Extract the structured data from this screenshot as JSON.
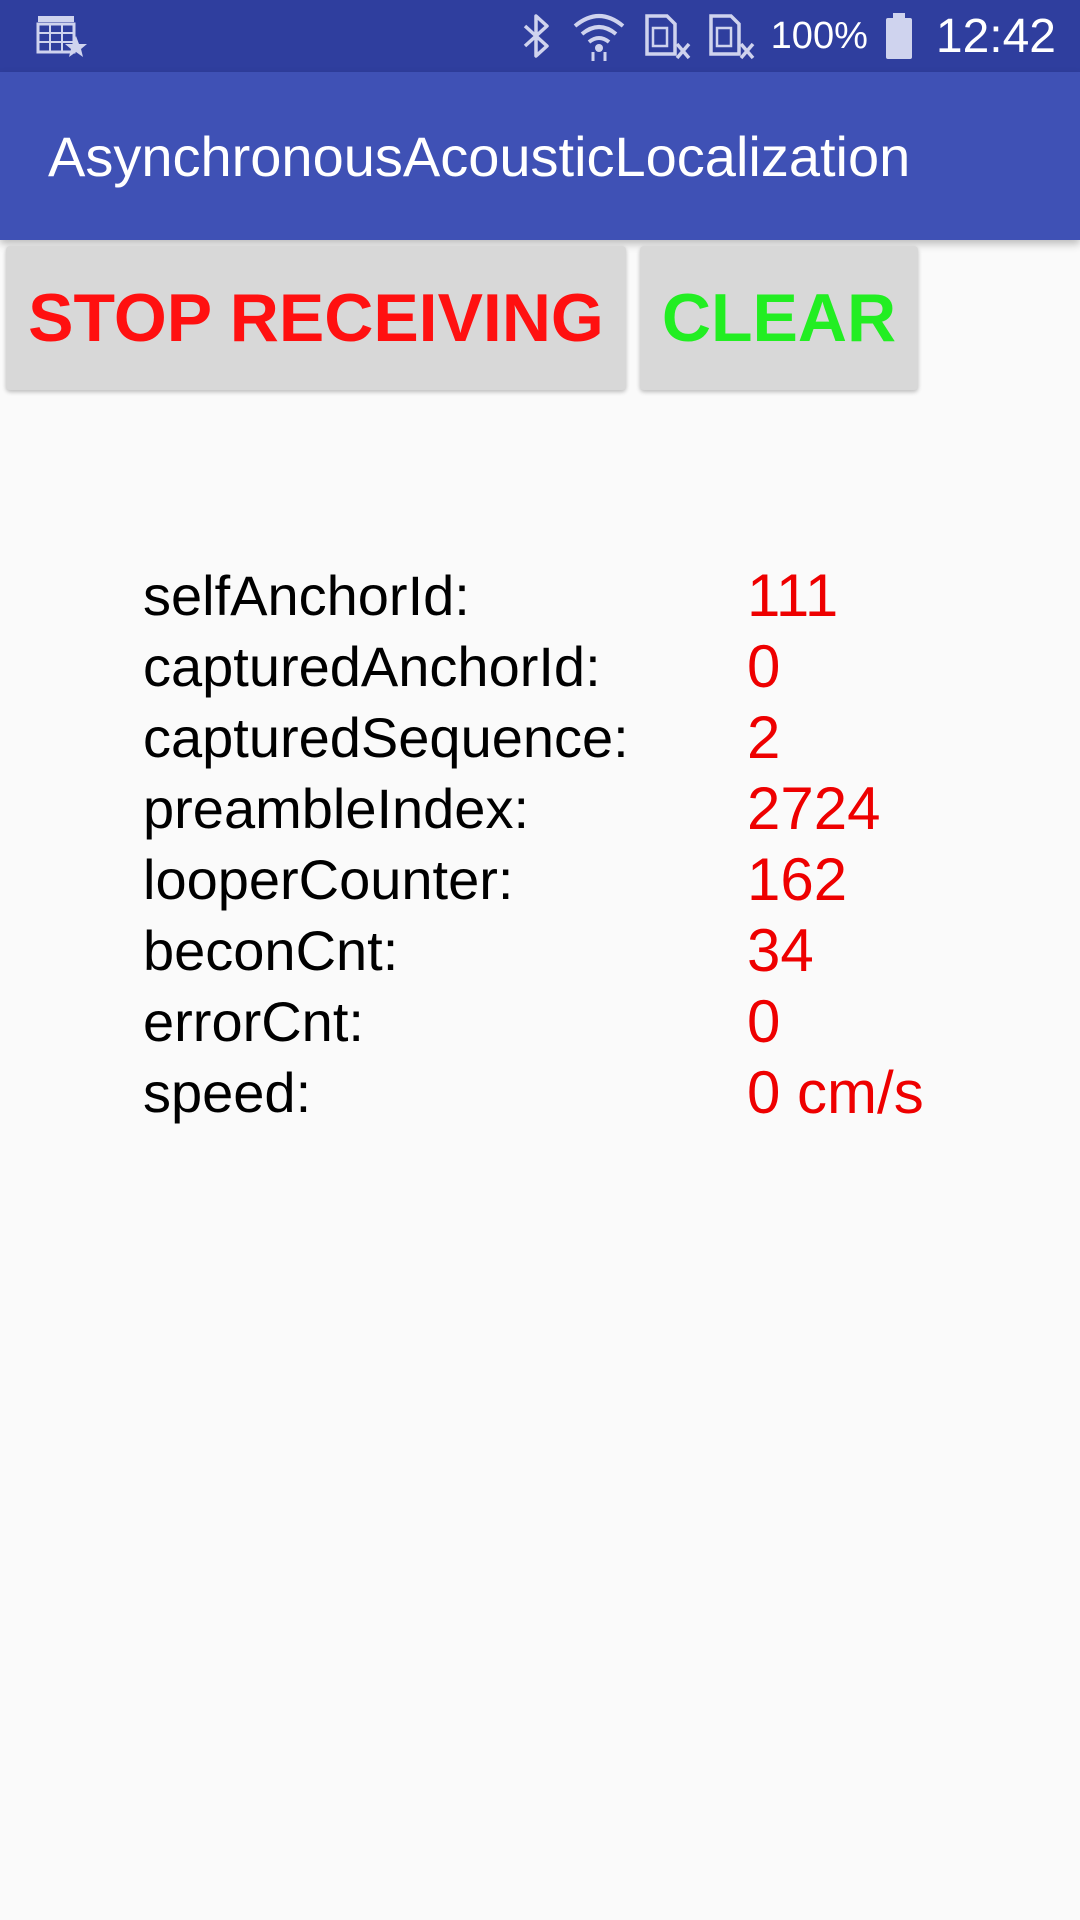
{
  "status_bar": {
    "battery": "100%",
    "time": "12:42",
    "icons": [
      "calendar-star-icon",
      "bluetooth-icon",
      "wifi-icon",
      "no-sim-icon",
      "no-sim-icon",
      "battery-icon"
    ]
  },
  "app_bar": {
    "title": "AsynchronousAcousticLocalization"
  },
  "buttons": {
    "stop_label": "STOP RECEIVING",
    "clear_label": "CLEAR"
  },
  "readout": {
    "rows": [
      {
        "label": "selfAnchorId:",
        "value": "111"
      },
      {
        "label": "capturedAnchorId:",
        "value": "0"
      },
      {
        "label": "capturedSequence:",
        "value": "2"
      },
      {
        "label": "preambleIndex:",
        "value": "2724"
      },
      {
        "label": "looperCounter:",
        "value": "162"
      },
      {
        "label": "beconCnt:",
        "value": "34"
      },
      {
        "label": "errorCnt:",
        "value": "0"
      },
      {
        "label": "speed:",
        "value": "0 cm/s"
      }
    ]
  },
  "colors": {
    "status_bar": "#2f3e9e",
    "app_bar": "#3f51b5",
    "stop_text": "#ff1010",
    "clear_text": "#22ee22",
    "value_text": "#ee0000"
  }
}
